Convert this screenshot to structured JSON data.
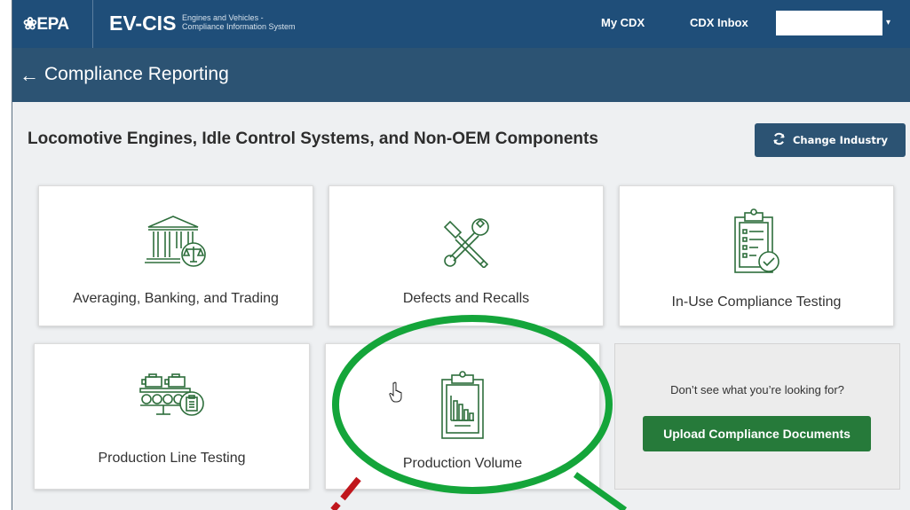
{
  "header": {
    "logo_text": "❀EPA",
    "app_name": "EV-CIS",
    "app_subtitle": "Engines and Vehicles -\nCompliance Information System",
    "nav": [
      {
        "label": "My CDX"
      },
      {
        "label": "CDX Inbox"
      }
    ],
    "user_menu_caret": "▾"
  },
  "subheader": {
    "back_icon": "←",
    "title": "Compliance Reporting"
  },
  "industry": {
    "title": "Locomotive Engines, Idle Control Systems, and Non-OEM Components",
    "change_button": "Change Industry",
    "change_icon": "refresh-icon"
  },
  "cards": [
    {
      "label": "Averaging, Banking, and Trading",
      "icon": "bank-scales-icon"
    },
    {
      "label": "Defects and Recalls",
      "icon": "tools-icon"
    },
    {
      "label": "In-Use Compliance Testing",
      "icon": "clipboard-check-icon"
    },
    {
      "label": "Production Line Testing",
      "icon": "conveyor-icon"
    },
    {
      "label": "Production Volume",
      "icon": "clipboard-chart-icon"
    }
  ],
  "help": {
    "text": "Don’t see what you’re looking for?",
    "upload_button": "Upload Compliance Documents"
  },
  "colors": {
    "header_bg": "#1f4e79",
    "subheader_bg": "#2c5373",
    "icon_green": "#2e6e3c",
    "upload_green": "#267a3a",
    "highlight_green": "#14a53a",
    "annotation_red": "#c0161c"
  }
}
